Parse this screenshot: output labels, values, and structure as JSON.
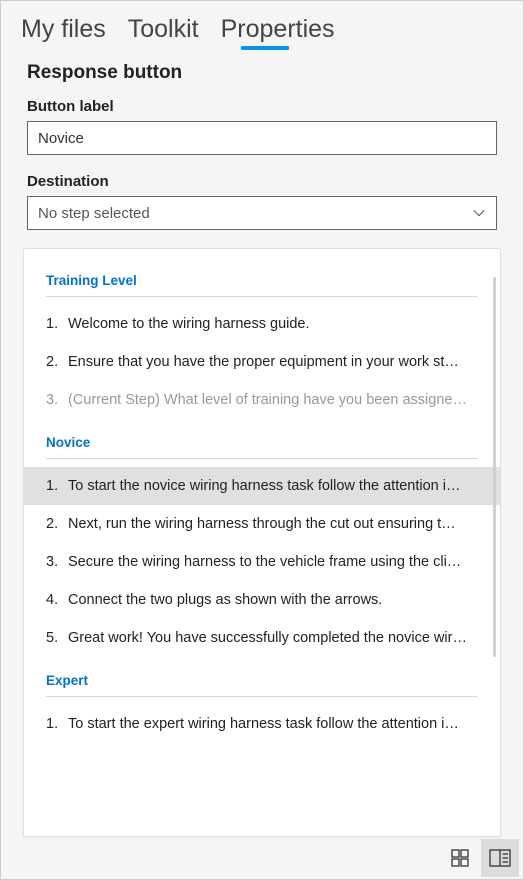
{
  "tabs": {
    "my_files": "My files",
    "toolkit": "Toolkit",
    "properties": "Properties"
  },
  "section_title": "Response button",
  "button_label": {
    "label": "Button label",
    "value": "Novice"
  },
  "destination": {
    "label": "Destination",
    "placeholder": "No step selected"
  },
  "groups": [
    {
      "title": "Training Level",
      "items": [
        {
          "num": "1.",
          "text": "Welcome to the wiring harness guide.",
          "muted": false,
          "highlight": false
        },
        {
          "num": "2.",
          "text": "Ensure that you have the proper equipment in your work st…",
          "muted": false,
          "highlight": false
        },
        {
          "num": "3.",
          "text": "(Current Step) What level of training have you been assigne…",
          "muted": true,
          "highlight": false
        }
      ]
    },
    {
      "title": "Novice",
      "items": [
        {
          "num": "1.",
          "text": "To start the novice wiring harness task follow the attention i…",
          "muted": false,
          "highlight": true
        },
        {
          "num": "2.",
          "text": "Next, run the wiring harness through the cut out ensuring t…",
          "muted": false,
          "highlight": false
        },
        {
          "num": "3.",
          "text": "Secure the wiring harness to the vehicle frame using the cli…",
          "muted": false,
          "highlight": false
        },
        {
          "num": "4.",
          "text": "Connect the two plugs as shown with the arrows.",
          "muted": false,
          "highlight": false
        },
        {
          "num": "5.",
          "text": "Great work! You have successfully completed the novice wir…",
          "muted": false,
          "highlight": false
        }
      ]
    },
    {
      "title": "Expert",
      "items": [
        {
          "num": "1.",
          "text": "To start the expert wiring harness task follow the attention i…",
          "muted": false,
          "highlight": false
        }
      ]
    }
  ]
}
